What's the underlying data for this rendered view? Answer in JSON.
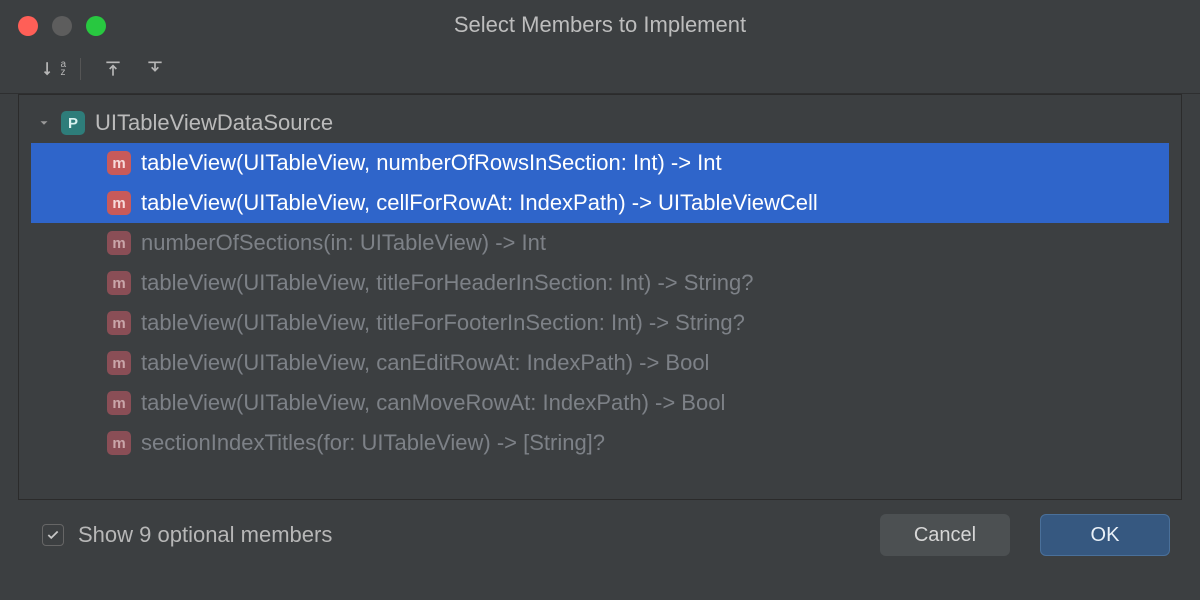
{
  "title": "Select Members to Implement",
  "protocol": {
    "name": "UITableViewDataSource",
    "badge": "P"
  },
  "members": [
    {
      "signature": "tableView(UITableView, numberOfRowsInSection: Int) -> Int",
      "badge": "m",
      "selected": true
    },
    {
      "signature": "tableView(UITableView, cellForRowAt: IndexPath) -> UITableViewCell",
      "badge": "m",
      "selected": true
    },
    {
      "signature": "numberOfSections(in: UITableView) -> Int",
      "badge": "m",
      "selected": false
    },
    {
      "signature": "tableView(UITableView, titleForHeaderInSection: Int) -> String?",
      "badge": "m",
      "selected": false
    },
    {
      "signature": "tableView(UITableView, titleForFooterInSection: Int) -> String?",
      "badge": "m",
      "selected": false
    },
    {
      "signature": "tableView(UITableView, canEditRowAt: IndexPath) -> Bool",
      "badge": "m",
      "selected": false
    },
    {
      "signature": "tableView(UITableView, canMoveRowAt: IndexPath) -> Bool",
      "badge": "m",
      "selected": false
    },
    {
      "signature": "sectionIndexTitles(for: UITableView) -> [String]?",
      "badge": "m",
      "selected": false
    }
  ],
  "footer": {
    "show_optional_label": "Show 9 optional members",
    "show_optional_checked": true,
    "cancel": "Cancel",
    "ok": "OK"
  }
}
